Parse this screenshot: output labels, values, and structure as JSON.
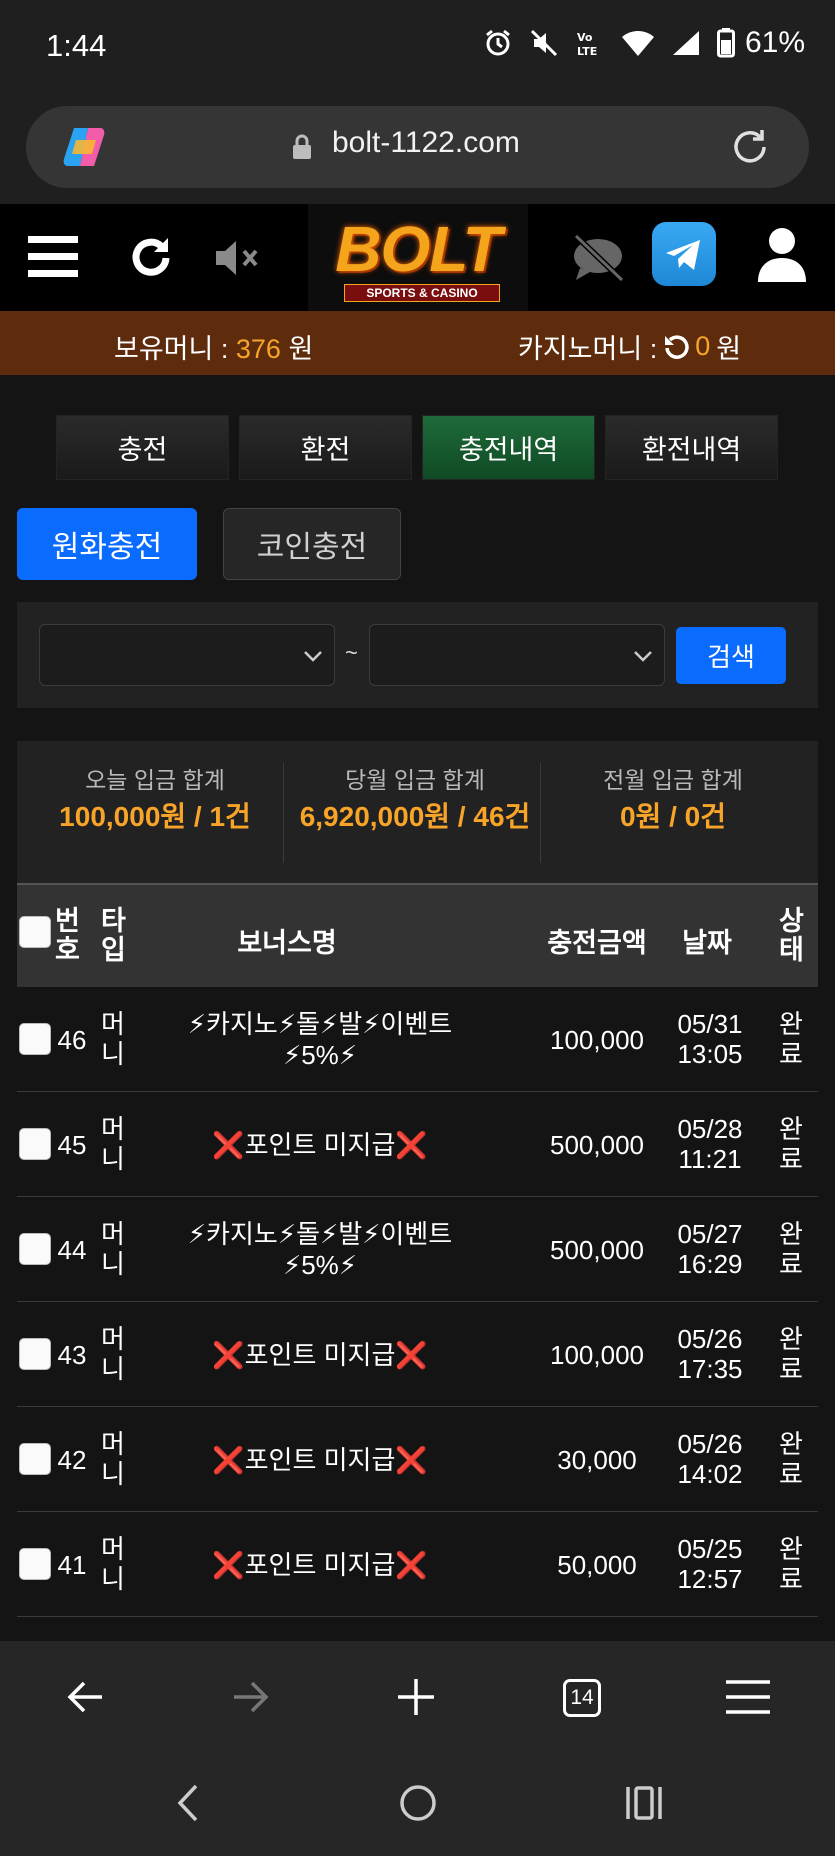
{
  "status": {
    "time": "1:44",
    "battery": "61%"
  },
  "browser": {
    "url": "bolt-1122.com",
    "tab_count": "14"
  },
  "site": {
    "logo_text": "BOLT",
    "logo_sub": "SPORTS & CASINO"
  },
  "balance": {
    "money_label": "보유머니 :",
    "money_value": "376",
    "money_unit": "원",
    "casino_label": "카지노머니 :",
    "casino_value": "0",
    "casino_unit": "원"
  },
  "tabs": [
    {
      "label": "충전"
    },
    {
      "label": "환전"
    },
    {
      "label": "충전내역"
    },
    {
      "label": "환전내역"
    }
  ],
  "subtabs": {
    "krw": "원화충전",
    "coin": "코인충전"
  },
  "search": {
    "tilde": "~",
    "button": "검색"
  },
  "summary": [
    {
      "label": "오늘 입금 합계",
      "value": "100,000원 / 1건"
    },
    {
      "label": "당월 입금 합계",
      "value": "6,920,000원 / 46건"
    },
    {
      "label": "전월 입금 합계",
      "value": "0원 / 0건"
    }
  ],
  "table": {
    "headers": {
      "no": "번호",
      "type": "타입",
      "bonus": "보너스명",
      "amount": "충전금액",
      "date": "날짜",
      "status": "상태"
    },
    "rows": [
      {
        "no": "46",
        "type": "머니",
        "bonus_line1": "⚡카지노⚡돌⚡발⚡이벤트",
        "bonus_line2": "⚡5%⚡",
        "amount": "100,000",
        "date": "05/31",
        "time": "13:05",
        "status": "완료"
      },
      {
        "no": "45",
        "type": "머니",
        "bonus_line1": "❌포인트 미지급❌",
        "bonus_line2": "",
        "amount": "500,000",
        "date": "05/28",
        "time": "11:21",
        "status": "완료"
      },
      {
        "no": "44",
        "type": "머니",
        "bonus_line1": "⚡카지노⚡돌⚡발⚡이벤트",
        "bonus_line2": "⚡5%⚡",
        "amount": "500,000",
        "date": "05/27",
        "time": "16:29",
        "status": "완료"
      },
      {
        "no": "43",
        "type": "머니",
        "bonus_line1": "❌포인트 미지급❌",
        "bonus_line2": "",
        "amount": "100,000",
        "date": "05/26",
        "time": "17:35",
        "status": "완료"
      },
      {
        "no": "42",
        "type": "머니",
        "bonus_line1": "❌포인트 미지급❌",
        "bonus_line2": "",
        "amount": "30,000",
        "date": "05/26",
        "time": "14:02",
        "status": "완료"
      },
      {
        "no": "41",
        "type": "머니",
        "bonus_line1": "❌포인트 미지급❌",
        "bonus_line2": "",
        "amount": "50,000",
        "date": "05/25",
        "time": "12:57",
        "status": "완료"
      }
    ]
  },
  "colors": {
    "accent_orange": "#f7a429",
    "primary_blue": "#0a6cff",
    "active_tab_green": "#1f6b3a",
    "balance_bar": "#5e2c0d"
  }
}
